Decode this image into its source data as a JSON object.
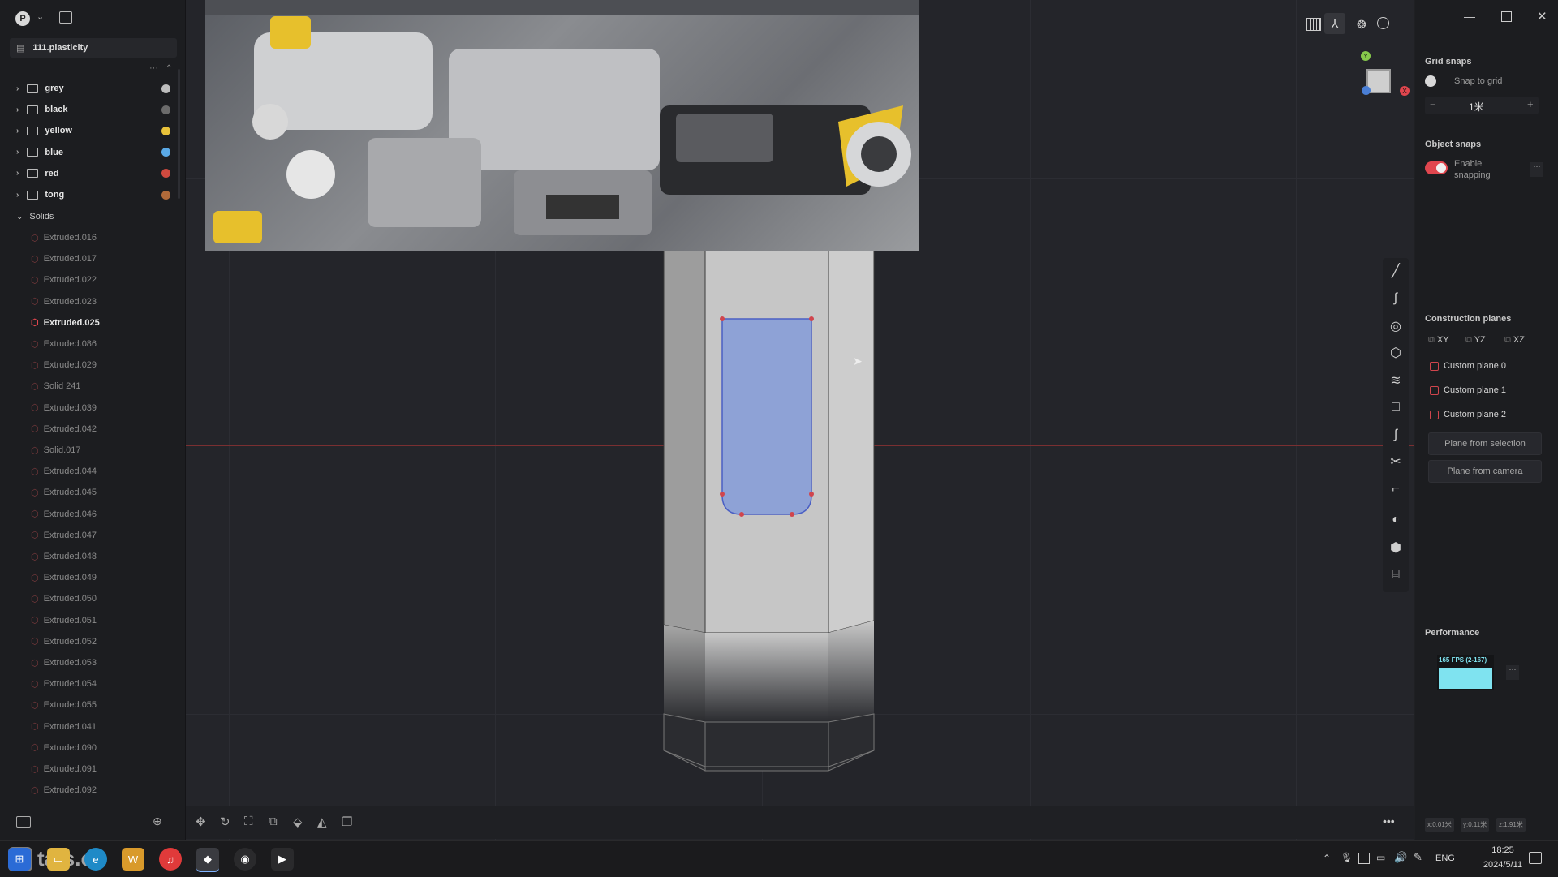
{
  "app": {
    "file_name": "111.plasticity",
    "user_initial": "P"
  },
  "outliner": {
    "folders": [
      {
        "label": "grey",
        "color": "#bdbdbd"
      },
      {
        "label": "black",
        "color": "#6b6b6b"
      },
      {
        "label": "yellow",
        "color": "#e8c23a"
      },
      {
        "label": "blue",
        "color": "#5aa9e6"
      },
      {
        "label": "red",
        "color": "#d04a3f"
      },
      {
        "label": "tong",
        "color": "#b06a3a"
      }
    ],
    "solids_label": "Solids",
    "solids": [
      "Extruded.016",
      "Extruded.017",
      "Extruded.022",
      "Extruded.023",
      "Extruded.025",
      "Extruded.086",
      "Extruded.029",
      "Solid 241",
      "Extruded.039",
      "Extruded.042",
      "Solid.017",
      "Extruded.044",
      "Extruded.045",
      "Extruded.046",
      "Extruded.047",
      "Extruded.048",
      "Extruded.049",
      "Extruded.050",
      "Extruded.051",
      "Extruded.052",
      "Extruded.053",
      "Extruded.054",
      "Extruded.055",
      "Extruded.041",
      "Extruded.090",
      "Extruded.091",
      "Extruded.092"
    ],
    "selected_solid": "Extruded.025"
  },
  "right_panel": {
    "grid_snaps_title": "Grid snaps",
    "snap_to_grid_label": "Snap to grid",
    "grid_value": "1米",
    "object_snaps_title": "Object snaps",
    "enable_snapping_label": "Enable snapping",
    "construction_planes_title": "Construction planes",
    "planes_axes": [
      "XY",
      "YZ",
      "XZ"
    ],
    "custom_planes": [
      "Custom plane 0",
      "Custom plane 1",
      "Custom plane 2"
    ],
    "plane_from_selection": "Plane from selection",
    "plane_from_camera": "Plane from camera",
    "performance_title": "Performance",
    "fps_label": "165 FPS (2-167)",
    "coords": [
      "x:0.01米",
      "y:0.11米",
      "z:1.91米"
    ]
  },
  "taskbar": {
    "time": "18:25",
    "date": "2024/5/11",
    "language": "ENG",
    "watermark": "tafs.cc"
  },
  "colors": {
    "accent_red": "#e0464e",
    "selection_fill": "#8ea2d6",
    "fps_bar": "#7fe3f0"
  }
}
